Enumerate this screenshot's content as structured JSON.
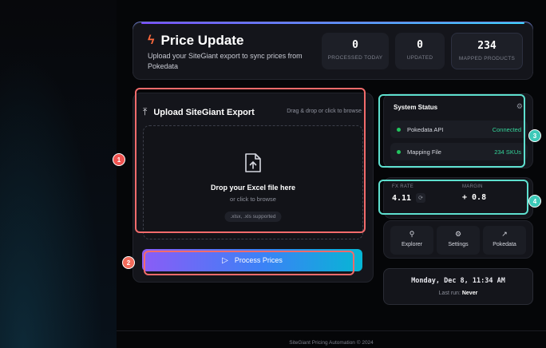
{
  "header": {
    "title": "Price Update",
    "subtitle": "Upload your SiteGiant export to sync prices from Pokedata",
    "stats": [
      {
        "value": "0",
        "label": "PROCESSED TODAY"
      },
      {
        "value": "0",
        "label": "UPDATED"
      },
      {
        "value": "234",
        "label": "MAPPED PRODUCTS"
      }
    ]
  },
  "upload": {
    "title": "Upload SiteGiant Export",
    "hint": "Drag & drop or click to browse",
    "drop_title": "Drop your Excel file here",
    "drop_sub": "or click to browse",
    "formats": ".xlsx, .xls supported",
    "process_label": "Process Prices"
  },
  "system_status": {
    "title": "System Status",
    "rows": [
      {
        "name": "Pokedata API",
        "value": "Connected"
      },
      {
        "name": "Mapping File",
        "value": "234 SKUs"
      }
    ]
  },
  "fx": {
    "rate_label": "FX RATE",
    "rate_value": "4.11",
    "margin_label": "MARGIN",
    "margin_value": "+ 0.8"
  },
  "links": [
    {
      "label": "Explorer",
      "icon": "search-icon"
    },
    {
      "label": "Settings",
      "icon": "gear-icon"
    },
    {
      "label": "Pokedata",
      "icon": "external-link-icon"
    }
  ],
  "clock": {
    "datetime": "Monday, Dec 8, 11:34 AM",
    "last_run_label": "Last run:",
    "last_run_value": "Never"
  },
  "footer": "SiteGiant Pricing Automation © 2024",
  "annotations": [
    "1",
    "2",
    "3",
    "4"
  ],
  "colors": {
    "accent_start": "#8b5cf6",
    "accent_end": "#06b6d4",
    "status_ok": "#22c55e",
    "annotation_red": "#f26b6b",
    "annotation_teal": "#5ee0cf"
  }
}
